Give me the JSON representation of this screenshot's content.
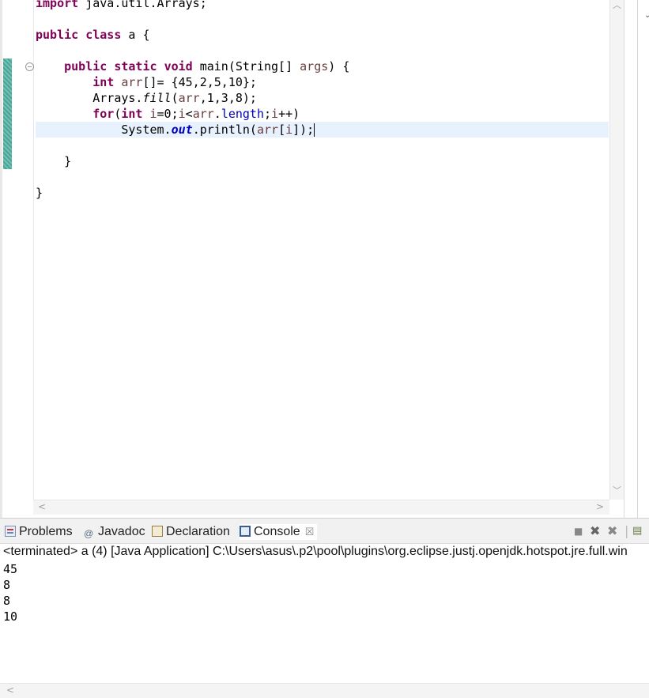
{
  "editor": {
    "lines": [
      [
        {
          "t": "import",
          "c": "kw"
        },
        {
          "t": " java.util.Arrays;"
        }
      ],
      [],
      [
        {
          "t": "public",
          "c": "kw"
        },
        {
          "t": " "
        },
        {
          "t": "class",
          "c": "kw"
        },
        {
          "t": " a {"
        }
      ],
      [],
      [
        {
          "t": "    "
        },
        {
          "t": "public",
          "c": "kw"
        },
        {
          "t": " "
        },
        {
          "t": "static",
          "c": "kw"
        },
        {
          "t": " "
        },
        {
          "t": "void",
          "c": "kw"
        },
        {
          "t": " main(String[] "
        },
        {
          "t": "args",
          "c": "var"
        },
        {
          "t": ") {"
        }
      ],
      [
        {
          "t": "        "
        },
        {
          "t": "int",
          "c": "kw"
        },
        {
          "t": " "
        },
        {
          "t": "arr",
          "c": "var"
        },
        {
          "t": "[]= {45,2,5,10};"
        }
      ],
      [
        {
          "t": "        Arrays."
        },
        {
          "t": "fill",
          "c": "ital"
        },
        {
          "t": "("
        },
        {
          "t": "arr",
          "c": "var"
        },
        {
          "t": ",1,3,8);"
        }
      ],
      [
        {
          "t": "        "
        },
        {
          "t": "for",
          "c": "kw"
        },
        {
          "t": "("
        },
        {
          "t": "int",
          "c": "kw"
        },
        {
          "t": " "
        },
        {
          "t": "i",
          "c": "var"
        },
        {
          "t": "=0;"
        },
        {
          "t": "i",
          "c": "var"
        },
        {
          "t": "<"
        },
        {
          "t": "arr",
          "c": "var"
        },
        {
          "t": "."
        },
        {
          "t": "length",
          "c": "field"
        },
        {
          "t": ";"
        },
        {
          "t": "i",
          "c": "var"
        },
        {
          "t": "++)"
        }
      ],
      [
        {
          "t": "            System."
        },
        {
          "t": "out",
          "c": "sfield"
        },
        {
          "t": ".println("
        },
        {
          "t": "arr",
          "c": "var"
        },
        {
          "t": "["
        },
        {
          "t": "i",
          "c": "var"
        },
        {
          "t": "]);"
        }
      ],
      [],
      [
        {
          "t": "    }"
        }
      ],
      [],
      [
        {
          "t": "}"
        }
      ]
    ],
    "current_line_index": 8
  },
  "console_view": {
    "tabs": [
      {
        "label": "Problems",
        "icon": "problems-icon"
      },
      {
        "label": "Javadoc",
        "icon": "javadoc-icon"
      },
      {
        "label": "Declaration",
        "icon": "declaration-icon"
      },
      {
        "label": "Console",
        "icon": "console-icon"
      }
    ],
    "active_tab": "Console",
    "status_line": "<terminated> a (4) [Java Application] C:\\Users\\asus\\.p2\\pool\\plugins\\org.eclipse.justj.openjdk.hotspot.jre.full.win",
    "output": [
      "45",
      "8",
      "8",
      "10"
    ]
  }
}
